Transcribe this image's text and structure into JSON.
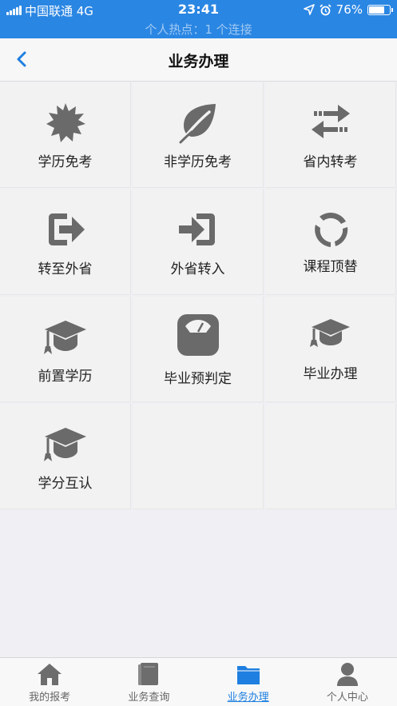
{
  "status_bar": {
    "carrier": "中国联通  4G",
    "time": "23:41",
    "battery": "76%",
    "battery_level": 0.76,
    "hotspot": "个人热点：1 个连接"
  },
  "nav": {
    "title": "业务办理"
  },
  "grid_items": [
    {
      "label": "学历免考",
      "icon": "badge-icon"
    },
    {
      "label": "非学历免考",
      "icon": "leaf-icon"
    },
    {
      "label": "省内转考",
      "icon": "transfer-arrows-icon"
    },
    {
      "label": "转至外省",
      "icon": "sign-out-icon"
    },
    {
      "label": "外省转入",
      "icon": "sign-in-icon"
    },
    {
      "label": "课程顶替",
      "icon": "refresh-icon"
    },
    {
      "label": "前置学历",
      "icon": "graduation-cap-icon"
    },
    {
      "label": "毕业预判定",
      "icon": "scale-icon"
    },
    {
      "label": "毕业办理",
      "icon": "graduation-cap-icon"
    },
    {
      "label": "学分互认",
      "icon": "graduation-cap-icon"
    }
  ],
  "tabs": [
    {
      "label": "我的报考",
      "icon": "home-icon",
      "active": false
    },
    {
      "label": "业务查询",
      "icon": "book-icon",
      "active": false
    },
    {
      "label": "业务办理",
      "icon": "folder-icon",
      "active": true
    },
    {
      "label": "个人中心",
      "icon": "user-icon",
      "active": false
    }
  ],
  "colors": {
    "accent": "#1e7fe0",
    "status_bar": "#2a86e3",
    "icon_gray": "#6a6a6a"
  }
}
